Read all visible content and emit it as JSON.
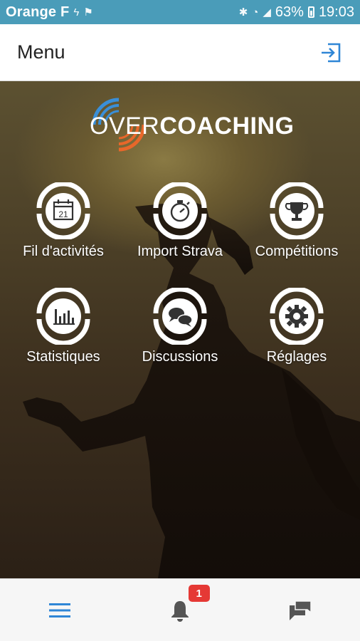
{
  "status_bar": {
    "carrier": "Orange F",
    "battery": "63%",
    "time": "19:03"
  },
  "header": {
    "title": "Menu"
  },
  "logo": {
    "over": "OVER",
    "coaching": "COACHING"
  },
  "menu": [
    {
      "label": "Fil d'activités",
      "icon": "calendar-icon"
    },
    {
      "label": "Import Strava",
      "icon": "stopwatch-icon"
    },
    {
      "label": "Compétitions",
      "icon": "trophy-icon"
    },
    {
      "label": "Statistiques",
      "icon": "bar-chart-icon"
    },
    {
      "label": "Discussions",
      "icon": "chat-bubbles-icon"
    },
    {
      "label": "Réglages",
      "icon": "gear-icon"
    }
  ],
  "calendar_day": "21",
  "bottom_nav": {
    "notifications_count": "1"
  },
  "colors": {
    "status_bar": "#4a9cb9",
    "accent": "#2f86d6",
    "badge": "#e53935",
    "logo_blue": "#3a8fd8",
    "logo_orange": "#e8672a"
  }
}
